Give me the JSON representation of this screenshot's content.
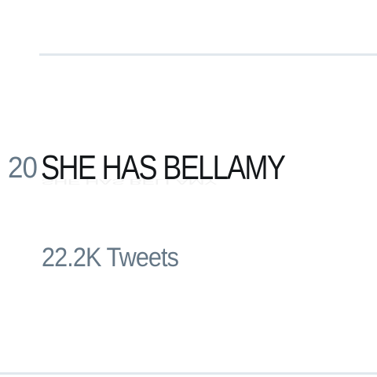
{
  "trend": {
    "rank": "20",
    "name": "SHE HAS BELLAMY",
    "tweet_count": "22.2K Tweets"
  }
}
